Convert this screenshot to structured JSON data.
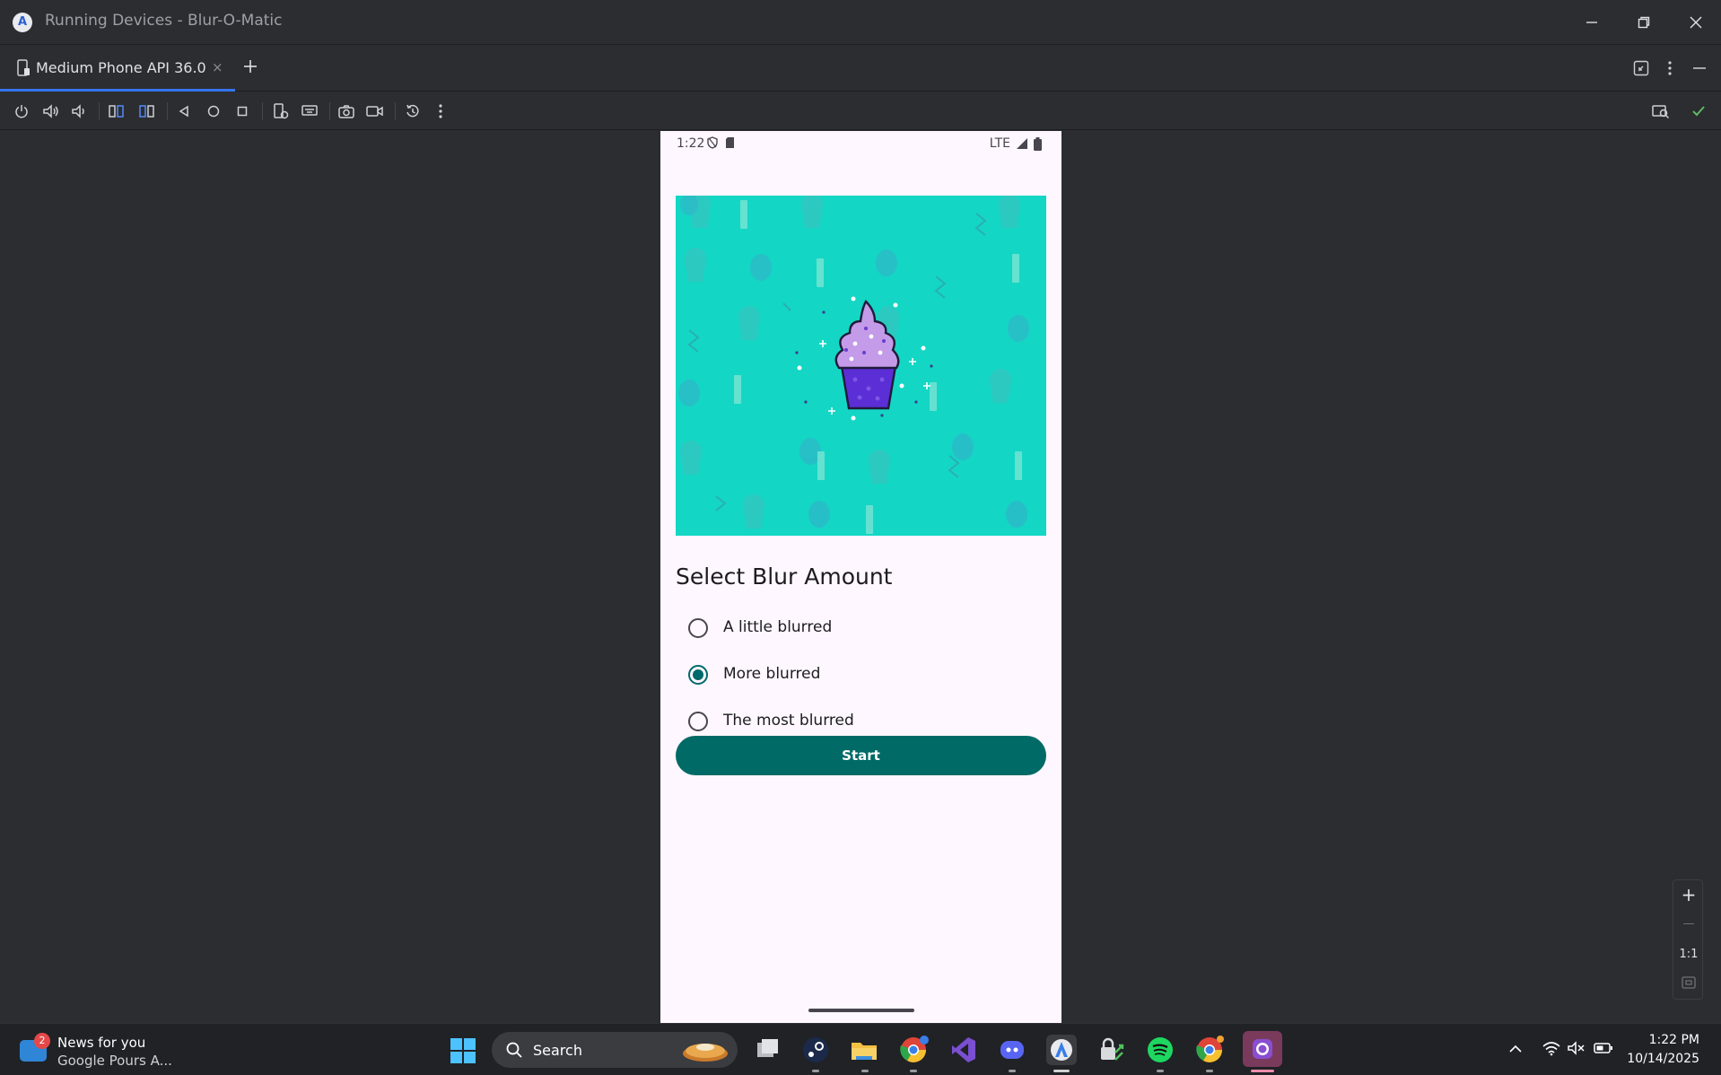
{
  "window": {
    "title": "Running Devices - Blur-O-Matic",
    "logo_glyph": "A"
  },
  "tabs": [
    {
      "label": "Medium Phone API 36.0",
      "close": "×",
      "active": true
    }
  ],
  "toolbar": {
    "icons": [
      "power-icon",
      "volume-up-icon",
      "volume-down-icon",
      "rotate-left-icon",
      "rotate-right-icon",
      "back-icon",
      "home-icon",
      "overview-icon",
      "device-settings-icon",
      "keyboard-icon",
      "screenshot-icon",
      "screen-record-icon",
      "reset-icon",
      "more-icon",
      "device-explorer-icon",
      "check-icon"
    ]
  },
  "phone": {
    "status_bar": {
      "time": "1:22",
      "network": "LTE"
    },
    "heading": "Select Blur Amount",
    "options": [
      {
        "label": "A little blurred",
        "selected": false
      },
      {
        "label": "More blurred",
        "selected": true
      },
      {
        "label": "The most blurred",
        "selected": false
      }
    ],
    "start_button": "Start",
    "colors": {
      "accent": "#00696b",
      "hero_bg": "#14d6c4",
      "surface": "#fef7ff"
    }
  },
  "zoom": {
    "plus": "+",
    "minus": "—",
    "one_to_one": "1:1"
  },
  "taskbar": {
    "news": {
      "badge": "2",
      "title": "News for you",
      "subtitle": "Google Pours A..."
    },
    "search_label": "Search",
    "apps": [
      "file-explorer-icon",
      "steam-icon",
      "folder-icon",
      "chrome-icon",
      "visual-studio-icon",
      "discord-icon",
      "android-studio-icon",
      "vpn-icon",
      "spotify-icon",
      "chrome-canary-icon",
      "github-desktop-icon"
    ],
    "clock": {
      "time": "1:22 PM",
      "date": "10/14/2025"
    }
  }
}
